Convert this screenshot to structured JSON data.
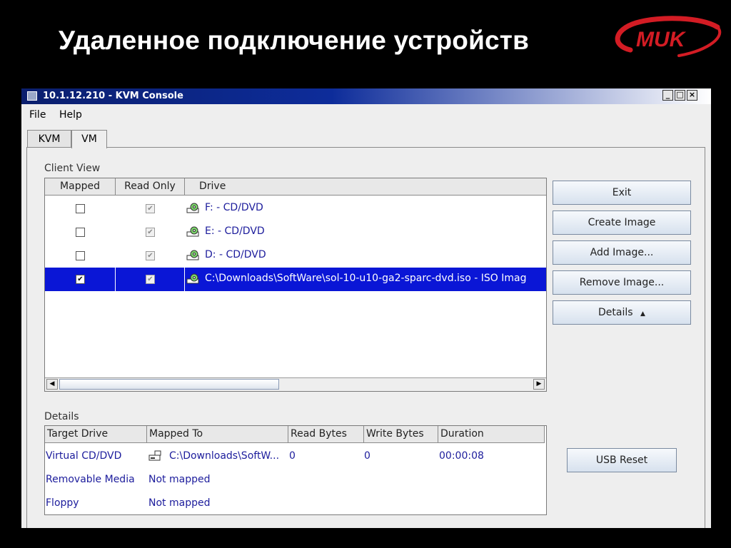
{
  "slide": {
    "title": "Удаленное подключение устройств",
    "logo_text": "MUK",
    "logo_color": "#d31c24"
  },
  "window": {
    "title": "10.1.12.210 - KVM Console",
    "controls": [
      "_",
      "□",
      "×"
    ]
  },
  "menu": {
    "items": [
      "File",
      "Help"
    ]
  },
  "tabs": [
    {
      "label": "KVM",
      "active": false
    },
    {
      "label": "VM",
      "active": true
    }
  ],
  "client_view": {
    "label": "Client View",
    "columns": [
      "Mapped",
      "Read Only",
      "Drive"
    ],
    "rows": [
      {
        "mapped": false,
        "read_only": true,
        "drive": "F: - CD/DVD",
        "icon": "cd-drive-icon",
        "selected": false
      },
      {
        "mapped": false,
        "read_only": true,
        "drive": "E: - CD/DVD",
        "icon": "cd-drive-icon",
        "selected": false
      },
      {
        "mapped": false,
        "read_only": true,
        "drive": "D: - CD/DVD",
        "icon": "cd-drive-icon",
        "selected": false
      },
      {
        "mapped": true,
        "read_only": true,
        "drive": "C:\\Downloads\\SoftWare\\sol-10-u10-ga2-sparc-dvd.iso - ISO Imag",
        "icon": "iso-image-icon",
        "selected": true
      }
    ],
    "selection_color": "#0a16d6"
  },
  "buttons": {
    "exit": "Exit",
    "create_image": "Create Image",
    "add_image": "Add Image...",
    "remove_image": "Remove Image...",
    "details": "Details",
    "details_icon": "arrow-up-icon",
    "usb_reset": "USB Reset"
  },
  "details": {
    "label": "Details",
    "columns": [
      "Target Drive",
      "Mapped To",
      "Read Bytes",
      "Write Bytes",
      "Duration"
    ],
    "rows": [
      {
        "target": "Virtual CD/DVD",
        "mapped_to": "C:\\Downloads\\SoftW...",
        "read_bytes": "0",
        "write_bytes": "0",
        "duration": "00:00:08",
        "icon": "disk-drive-icon"
      },
      {
        "target": "Removable Media",
        "mapped_to": "Not mapped",
        "read_bytes": "",
        "write_bytes": "",
        "duration": ""
      },
      {
        "target": "Floppy",
        "mapped_to": "Not mapped",
        "read_bytes": "",
        "write_bytes": "",
        "duration": ""
      }
    ]
  }
}
